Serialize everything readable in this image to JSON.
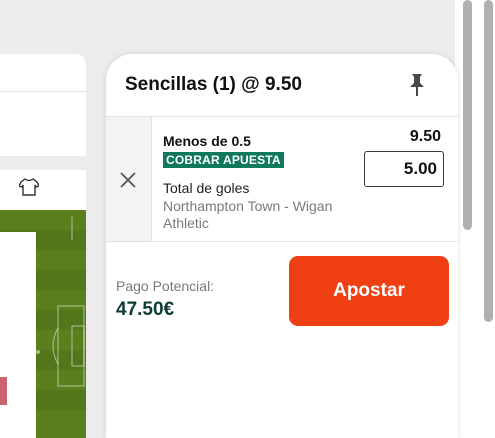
{
  "slip": {
    "title": "Sencillas (1) @ 9.50",
    "selection": {
      "name": "Menos de 0.5",
      "badge": "COBRAR APUESTA",
      "market": "Total de goles",
      "event": "Northampton Town - Wigan Athletic",
      "odds": "9.50",
      "stake": "5.00"
    },
    "payout_label": "Pago Potencial:",
    "payout_value": "47.50€",
    "place_bet_label": "Apostar"
  },
  "colors": {
    "accent": "#f03f12",
    "badge": "#0e7a5a",
    "payout_text": "#0e3b35",
    "pitch": "#5a7f1d"
  },
  "icons": [
    "pin-icon",
    "close-icon",
    "shirt-icon"
  ]
}
